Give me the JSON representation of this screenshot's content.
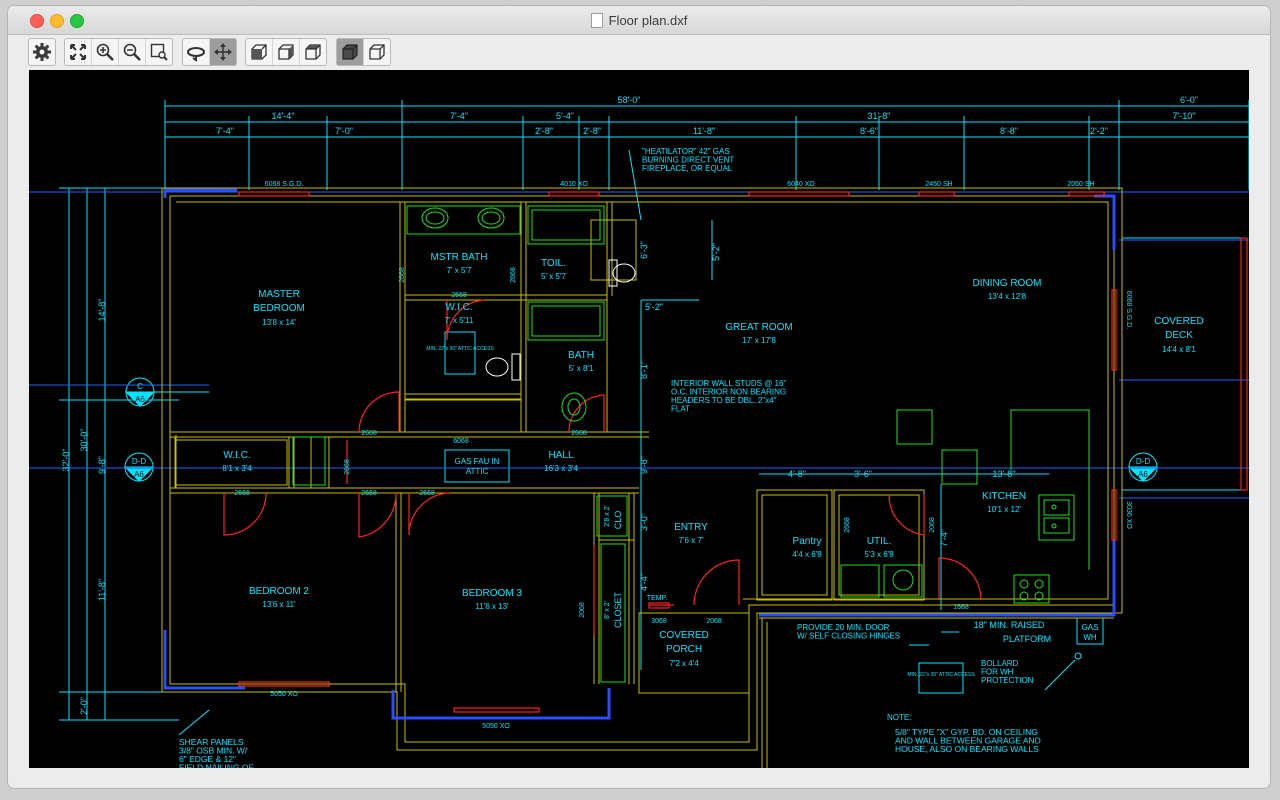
{
  "window": {
    "title": "Floor plan.dxf"
  },
  "toolbar": {
    "groups": [
      [
        "settings-gear"
      ],
      [
        "zoom-extents",
        "zoom-in",
        "zoom-out",
        "zoom-window"
      ],
      [
        "orbit",
        "pan"
      ],
      [
        "view-front",
        "view-side",
        "view-iso"
      ],
      [
        "shaded-mode",
        "wireframe-mode"
      ]
    ],
    "active": [
      "pan",
      "shaded-mode"
    ]
  },
  "drawing": {
    "dims_top": [
      "58'-0\"",
      "6'-0\"",
      "14'-4\"",
      "7'-4\"",
      "5'-4\"",
      "31'-8\"",
      "7'-10\"",
      "7'-4\"",
      "7'-0\"",
      "2'-8\"",
      "2'-8\"",
      "11'-8\"",
      "8'-6\"",
      "8'-8\"",
      "2'-2\""
    ],
    "dims_left": [
      "32'-0\"",
      "30'-0\"",
      "14'-8\"",
      "11'-8\"",
      "2'-0\"",
      "9'-8\""
    ],
    "dims_inner": [
      "5'-2\"",
      "5'-2\"",
      "6'-3\"",
      "8'-1\"",
      "9'-8\"",
      "3'-0\"",
      "4'-4\"",
      "7'-4\"",
      "4'-8\"",
      "3'-6\"",
      "13'-8\""
    ],
    "window_tags": [
      "6068 S.G.D.",
      "4010 XO",
      "6040 XO",
      "2450 SH",
      "2050 SH",
      "6068 S.G.D.",
      "3036 XO",
      "5050 XO",
      "5050 XO"
    ],
    "door_tags": [
      "2668",
      "2668",
      "2668",
      "2668",
      "2668",
      "6068",
      "2668",
      "2668",
      "2668",
      "2668",
      "2668",
      "2068",
      "1668",
      "3068",
      "2068",
      "2068"
    ],
    "rooms": [
      {
        "name": "MASTER",
        "name2": "BEDROOM",
        "size": "13'8 x 14'"
      },
      {
        "name": "MSTR BATH",
        "size": "7' x 5'7"
      },
      {
        "name": "TOIL.",
        "size": "5' x 5'7"
      },
      {
        "name": "W.I.C.",
        "size": "7' x 5'11"
      },
      {
        "name": "BATH",
        "size": "5' x 8'1"
      },
      {
        "name": "GREAT ROOM",
        "size": "17' x 17'8"
      },
      {
        "name": "DINING ROOM",
        "size": "13'4 x 12'8"
      },
      {
        "name": "COVERED",
        "name2": "DECK",
        "size": "14'4 x 8'1"
      },
      {
        "name": "W.I.C.",
        "size": "8'1 x 3'4"
      },
      {
        "name": "HALL",
        "size": "16'3 x 3'4"
      },
      {
        "name": "KITCHEN",
        "size": "10'1 x 12'"
      },
      {
        "name": "ENTRY",
        "size": "7'6 x 7'"
      },
      {
        "name": "Pantry",
        "size": "4'4 x 6'8"
      },
      {
        "name": "UTIL.",
        "size": "5'3 x 6'8"
      },
      {
        "name": "BEDROOM 2",
        "size": "13'6 x 11'"
      },
      {
        "name": "BEDROOM 3",
        "size": "11'6 x 13'"
      },
      {
        "name": "COVERED",
        "name2": "PORCH",
        "size": "7'2 x 4'4"
      }
    ],
    "labels": {
      "clo": "CLO",
      "closet": "CLOSET",
      "closet_size": "8' x 2'",
      "clo_size": "2'8 x 2'",
      "temp": "TEMP.",
      "attic_access": "MIN. 22\"x 30\" ATTIC ACCESS",
      "attic_access2": "MIN. 22\"x 30\" ATTIC ACCESS",
      "gas_fau": "GAS FAU IN",
      "gas_fau2": "ATTIC",
      "gas_wh": "GAS",
      "gas_wh2": "WH",
      "section_c": "C",
      "section_d": "D-D",
      "section_ref": "A6"
    },
    "notes": {
      "fireplace": [
        "\"HEATILATOR\" 42\" GAS",
        "BURNING DIRECT VENT",
        "FIREPLACE, OR EQUAL"
      ],
      "interior_walls": [
        "INTERIOR WALL STUDS @ 16\"",
        "O.C. INTERIOR NON BEARING",
        "HEADERS TO BE DBL. 2\"x4\"",
        "FLAT"
      ],
      "door_note": [
        "PROVIDE 20 MIN. DOOR",
        "W/ SELF CLOSING HINGES"
      ],
      "platform": [
        "18\" MIN. RAISED",
        "PLATFORM"
      ],
      "bollard": [
        "BOLLARD",
        "FOR WH",
        "PROTECTION"
      ],
      "note_title": "NOTE:",
      "note_body": [
        "5/8\" TYPE \"X\" GYP. BD. ON CEILING",
        "AND WALL BETWEEN GARAGE AND",
        "HOUSE, ALSO ON BEARING WALLS"
      ],
      "shear": [
        "SHEAR PANELS",
        "3/8\" OSB MIN. W/",
        "6\" EDGE & 12\"",
        "FIELD NAILING OF"
      ]
    }
  },
  "colors": {
    "background": "#000000",
    "dimension": "#00e5ff",
    "wall": "#d8d000",
    "window": "#ff2020",
    "fixture": "#20e020",
    "structure": "#2060ff",
    "text": "#00e5ff"
  }
}
